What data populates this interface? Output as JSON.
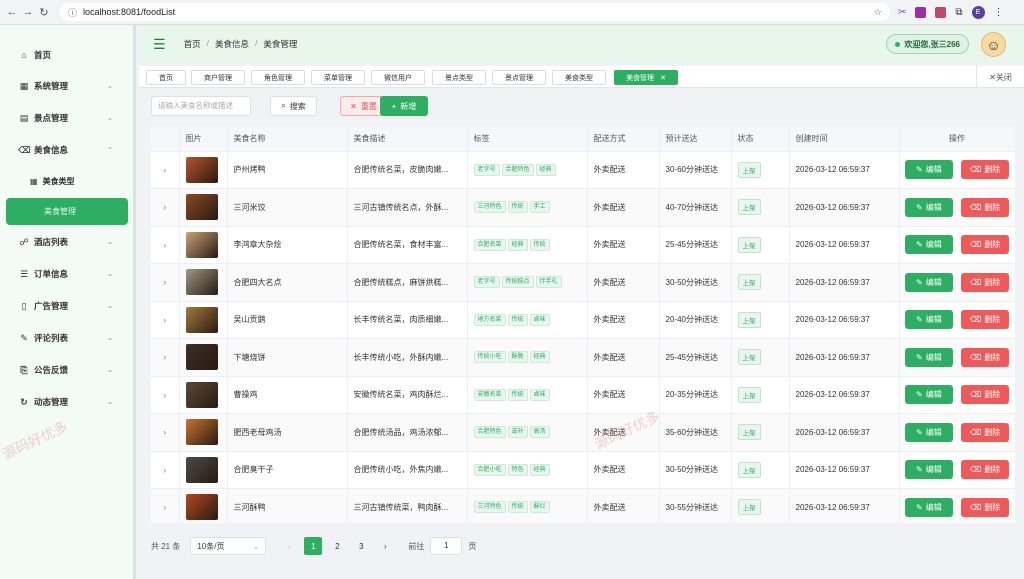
{
  "browser": {
    "url": "localhost:8081/foodList"
  },
  "sidebar": {
    "items": [
      {
        "label": "首页",
        "icon": "home-icon",
        "glyph": "⌂"
      },
      {
        "label": "系统管理",
        "icon": "grid-icon",
        "glyph": "▦"
      },
      {
        "label": "景点管理",
        "icon": "building-icon",
        "glyph": "▤"
      },
      {
        "label": "美食信息",
        "icon": "trash-icon",
        "glyph": "🗑"
      },
      {
        "label": "酒店列表",
        "icon": "hotel-icon",
        "glyph": "☍"
      },
      {
        "label": "订单信息",
        "icon": "order-icon",
        "glyph": "☰"
      },
      {
        "label": "广告管理",
        "icon": "phone-icon",
        "glyph": "▯"
      },
      {
        "label": "评论列表",
        "icon": "comment-icon",
        "glyph": "✎"
      },
      {
        "label": "公告反馈",
        "icon": "notice-icon",
        "glyph": "⎘"
      },
      {
        "label": "动态管理",
        "icon": "refresh-icon",
        "glyph": "↻"
      }
    ],
    "sub_items": [
      {
        "label": "美食类型",
        "icon": "grid-icon"
      },
      {
        "label": "美食管理"
      }
    ]
  },
  "header": {
    "breadcrumbs": [
      "首页",
      "美食信息",
      "美食管理"
    ],
    "welcome": "欢迎您,张三266"
  },
  "tabs": [
    "首页",
    "商户管理",
    "角色管理",
    "菜单管理",
    "微信用户",
    "景点类型",
    "景点管理",
    "美食类型",
    "美食管理"
  ],
  "close_all": "关闭",
  "toolbar": {
    "search_placeholder": "请输入美食名称或描述",
    "search_label": "搜索",
    "reset_label": "重置",
    "add_label": "新增"
  },
  "table": {
    "headers": [
      "",
      "图片",
      "美食名称",
      "美食描述",
      "标签",
      "配送方式",
      "预计送达",
      "状态",
      "创建时间",
      "操作"
    ],
    "edit_label": "编辑",
    "delete_label": "删除",
    "rows": [
      {
        "name": "庐州烤鸭",
        "desc": "合肥传统名菜，皮脆肉嫩...",
        "tags": [
          "老字号",
          "合肥特色",
          "经典"
        ],
        "delivery": "外卖配送",
        "eta": "30-60分钟送达",
        "status": "上架",
        "created": "2026-03-12 06:59:37",
        "img": "#b5542d"
      },
      {
        "name": "三河米饺",
        "desc": "三河古镇传统名点，外酥...",
        "tags": [
          "三河特色",
          "传统",
          "手工"
        ],
        "delivery": "外卖配送",
        "eta": "40-70分钟送达",
        "status": "上架",
        "created": "2026-03-12 06:59:37",
        "img": "#8a4a24"
      },
      {
        "name": "李鸿章大杂烩",
        "desc": "合肥传统名菜，食材丰富...",
        "tags": [
          "合肥名菜",
          "经典",
          "传统"
        ],
        "delivery": "外卖配送",
        "eta": "25-45分钟送达",
        "status": "上架",
        "created": "2026-03-12 06:59:37",
        "img": "#c9a27a"
      },
      {
        "name": "合肥四大名点",
        "desc": "合肥传统糕点，麻饼烘糕...",
        "tags": [
          "老字号",
          "传统糕点",
          "伴手礼"
        ],
        "delivery": "外卖配送",
        "eta": "30-50分钟送达",
        "status": "上架",
        "created": "2026-03-12 06:59:37",
        "img": "#9e9a86"
      },
      {
        "name": "吴山贡鹅",
        "desc": "长丰传统名菜，肉质细嫩...",
        "tags": [
          "地方名菜",
          "传统",
          "卤味"
        ],
        "delivery": "外卖配送",
        "eta": "20-40分钟送达",
        "status": "上架",
        "created": "2026-03-12 06:59:37",
        "img": "#a37a3e"
      },
      {
        "name": "下塘烧饼",
        "desc": "长丰传统小吃，外酥内嫩...",
        "tags": [
          "传统小吃",
          "酥脆",
          "经典"
        ],
        "delivery": "外卖配送",
        "eta": "25-45分钟送达",
        "status": "上架",
        "created": "2026-03-12 06:59:37",
        "img": "#3d3028"
      },
      {
        "name": "曹操鸡",
        "desc": "安徽传统名菜，鸡肉酥烂...",
        "tags": [
          "安徽名菜",
          "传统",
          "卤味"
        ],
        "delivery": "外卖配送",
        "eta": "20-35分钟送达",
        "status": "上架",
        "created": "2026-03-12 06:59:37",
        "img": "#5a4a38"
      },
      {
        "name": "肥西老母鸡汤",
        "desc": "合肥传统汤品，鸡汤浓郁...",
        "tags": [
          "合肥特色",
          "滋补",
          "高汤"
        ],
        "delivery": "外卖配送",
        "eta": "35-60分钟送达",
        "status": "上架",
        "created": "2026-03-12 06:59:37",
        "img": "#c8742e"
      },
      {
        "name": "合肥臭干子",
        "desc": "合肥传统小吃，外焦内嫩...",
        "tags": [
          "合肥小吃",
          "特色",
          "经典"
        ],
        "delivery": "外卖配送",
        "eta": "30-50分钟送达",
        "status": "上架",
        "created": "2026-03-12 06:59:37",
        "img": "#4a4a4a"
      },
      {
        "name": "三河酥鸭",
        "desc": "三河古镇传统菜，鸭肉酥...",
        "tags": [
          "三河特色",
          "传统",
          "酥烂"
        ],
        "delivery": "外卖配送",
        "eta": "30-55分钟送达",
        "status": "上架",
        "created": "2026-03-12 06:59:37",
        "img": "#b04a22"
      }
    ]
  },
  "pagination": {
    "total": "共 21 条",
    "page_size": "10条/页",
    "pages": [
      "1",
      "2",
      "3"
    ],
    "current": "1",
    "goto_label": "前往",
    "goto_value": "1",
    "page_unit": "页"
  },
  "watermark": "源码好优多"
}
